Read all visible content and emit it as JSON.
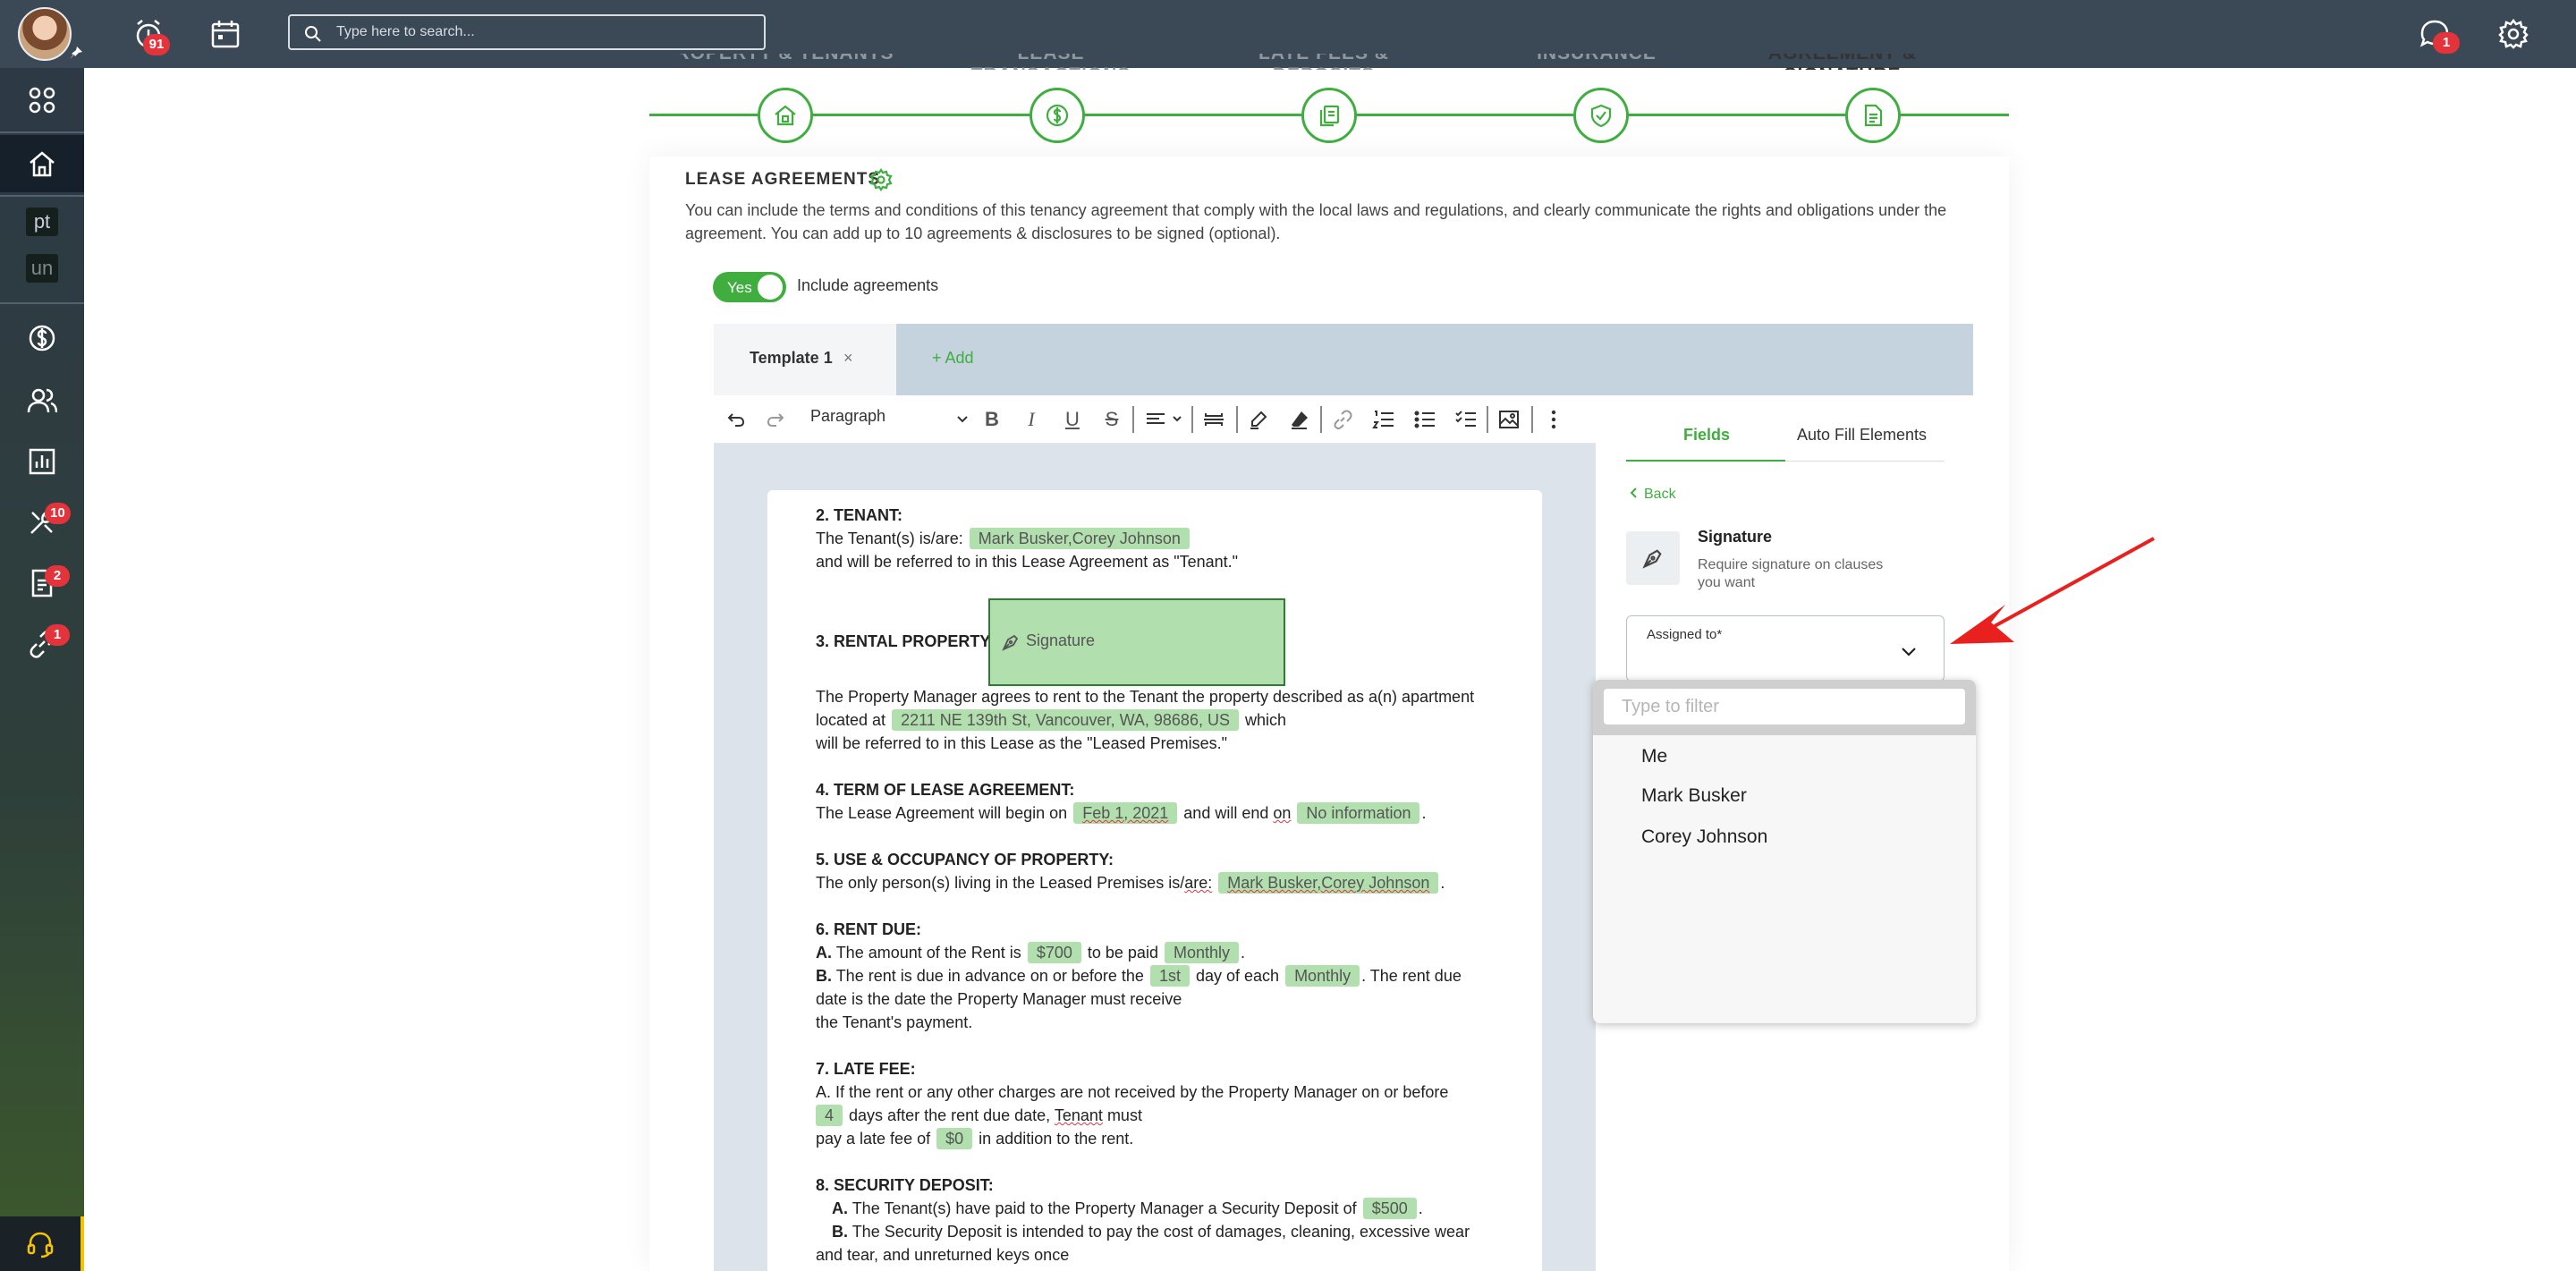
{
  "topbar": {
    "notification_badge": "91",
    "search_placeholder": "Type here to search...",
    "chat_badge": "1"
  },
  "sidebar": {
    "text_items": [
      "pt",
      "un"
    ],
    "badges": {
      "tools": "10",
      "documents": "2",
      "links": "1"
    }
  },
  "stepper": {
    "steps": [
      "PROPERTY & TENANTS",
      "LEASE TRANSACTIONS",
      "LATE FEES & DEPOSITS",
      "INSURANCE",
      "AGREEMENT & SIGNATURE"
    ]
  },
  "section": {
    "title": "LEASE AGREEMENTS",
    "description": "You can include the terms and conditions of this tenancy agreement that comply with the local laws and regulations, and clearly communicate the rights and obligations under the agreement. You can add up to 10 agreements & disclosures to be signed (optional).",
    "toggle_text": "Yes",
    "toggle_label": "Include agreements"
  },
  "tabs": {
    "active": "Template 1",
    "close": "×",
    "add": "+ Add"
  },
  "toolbar": {
    "block_style": "Paragraph"
  },
  "document": {
    "tenant_heading": "2. TENANT:",
    "tenant_line1_prefix": "The Tenant(s) is/are:",
    "tenant_names": "Mark Busker,Corey Johnson",
    "tenant_line2": "and will be referred to in this Lease Agreement as \"Tenant.\"",
    "rental_heading": "3. RENTAL PROPERTY:",
    "signature_field": "Signature",
    "rental_line1": "The Property Manager agrees to rent to the Tenant the property described as a(n) apartment",
    "rental_line2_prefix": "located at",
    "address": "2211 NE 139th St, Vancouver, WA, 98686, US",
    "rental_line2_suffix": "which",
    "rental_line3": "will be referred to in this Lease as the \"Leased Premises.\"",
    "term_heading": "4. TERM OF LEASE AGREEMENT:",
    "term_prefix": "The Lease Agreement will begin on",
    "start_date": "Feb 1, 2021",
    "term_mid": "and will end",
    "term_on": "on",
    "end_date": "No information",
    "use_heading": "5. USE & OCCUPANCY OF PROPERTY:",
    "use_prefix": "The only person(s) living in the Leased Premises is/",
    "use_are": "are:",
    "rent_heading": "6. RENT DUE:",
    "rent_a_label": "A.",
    "rent_a_prefix": "The amount of the Rent is",
    "rent_amount": "$700",
    "rent_a_mid": "to be paid",
    "rent_freq": "Monthly",
    "rent_b_label": "B.",
    "rent_b_prefix": "The rent is due in advance on or before the",
    "due_day": "1st",
    "rent_b_mid": "day of each",
    "rent_b_suffix": ". The rent due",
    "rent_b_line2": "date is the date the Property Manager must receive",
    "rent_b_line3": "the Tenant's payment.",
    "late_heading": "7. LATE FEE:",
    "late_line1": "A. If the rent or any other charges are not received by the Property Manager on or before",
    "late_days": "4",
    "late_line2_mid": "days after the rent due date,",
    "late_tenant": "Tenant",
    "late_line2_suffix": "must",
    "late_line3_prefix": "pay a late fee of",
    "late_fee": "$0",
    "late_line3_suffix": "in addition to the rent.",
    "deposit_heading": "8. SECURITY DEPOSIT:",
    "deposit_a_label": "A.",
    "deposit_a_prefix": "The Tenant(s) have paid to the Property Manager a Security Deposit of",
    "deposit_amount": "$500",
    "deposit_b_label": "B.",
    "deposit_b_text": "The Security Deposit is intended to pay the cost of damages, cleaning, excessive wear",
    "deposit_b_line2": "and tear, and unreturned keys once"
  },
  "panel": {
    "tabs": [
      "Fields",
      "Auto Fill Elements"
    ],
    "back": "Back",
    "field_title": "Signature",
    "field_desc": "Require signature on clauses you want",
    "assigned_label": "Assigned to*",
    "filter_placeholder": "Type to filter",
    "options": [
      "Me",
      "Mark Busker",
      "Corey Johnson"
    ]
  },
  "colors": {
    "accent": "#3fae3f",
    "topbar": "#3b4956",
    "badge": "#e3343c",
    "chip": "#b2dfae",
    "annotation_arrow": "#e8201e"
  }
}
